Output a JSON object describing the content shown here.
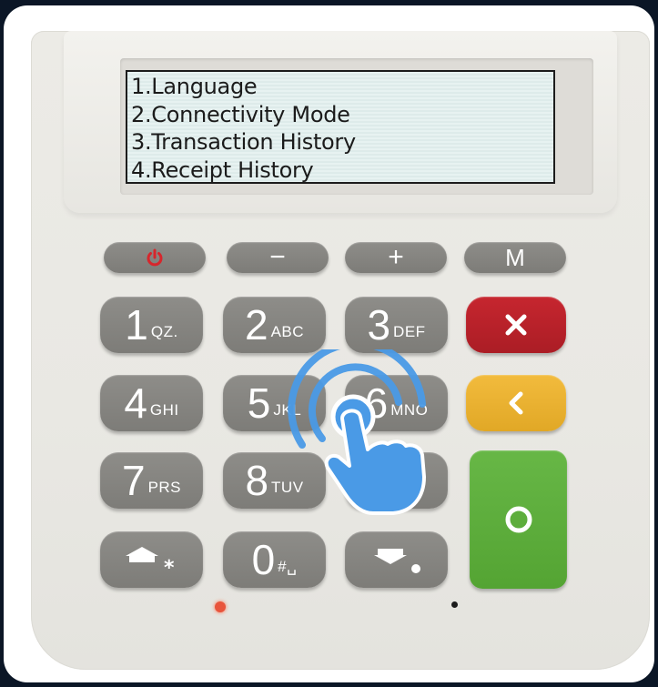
{
  "lcd": {
    "lines": [
      "1.Language",
      "2.Connectivity Mode",
      "3.Transaction History",
      "4.Receipt History"
    ]
  },
  "function_keys": {
    "minus": "−",
    "plus": "+",
    "menu": "M"
  },
  "keypad": {
    "k1": {
      "digit": "1",
      "letters": "QZ."
    },
    "k2": {
      "digit": "2",
      "letters": "ABC"
    },
    "k3": {
      "digit": "3",
      "letters": "DEF"
    },
    "k4": {
      "digit": "4",
      "letters": "GHI"
    },
    "k5": {
      "digit": "5",
      "letters": "JKL"
    },
    "k6": {
      "digit": "6",
      "letters": "MNO"
    },
    "k7": {
      "digit": "7",
      "letters": "PRS"
    },
    "k8": {
      "digit": "8",
      "letters": "TUV"
    },
    "k0": {
      "digit": "0",
      "letters": "#␣"
    }
  },
  "colors": {
    "cancel": "#c6262f",
    "back": "#f2bb3d",
    "enter": "#67b746",
    "key_gray": "#8e8d89",
    "power_icon": "#d7262c",
    "tap_gesture": "#4a9ae6"
  },
  "icons": [
    "power-icon",
    "close-icon",
    "back-chevron-icon",
    "enter-circle-icon",
    "shift-up-star-icon",
    "shift-down-dot-icon",
    "tap-hand-icon"
  ]
}
